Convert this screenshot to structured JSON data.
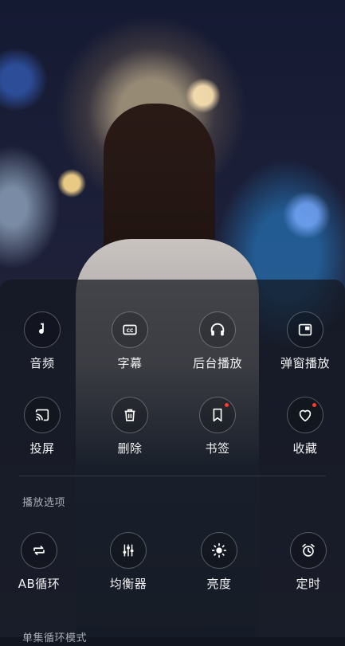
{
  "panel": {
    "row1": [
      {
        "label": "音频",
        "icon": "music-note-icon"
      },
      {
        "label": "字幕",
        "icon": "closed-caption-icon"
      },
      {
        "label": "后台播放",
        "icon": "headphones-icon"
      },
      {
        "label": "弹窗播放",
        "icon": "picture-in-picture-icon"
      }
    ],
    "row2": [
      {
        "label": "投屏",
        "icon": "cast-icon"
      },
      {
        "label": "删除",
        "icon": "trash-icon"
      },
      {
        "label": "书签",
        "icon": "bookmark-icon",
        "badge": true
      },
      {
        "label": "收藏",
        "icon": "heart-icon",
        "badge": true
      }
    ],
    "section_title": "播放选项",
    "row3": [
      {
        "label": "AB循环",
        "icon": "ab-loop-icon"
      },
      {
        "label": "均衡器",
        "icon": "equalizer-icon"
      },
      {
        "label": "亮度",
        "icon": "brightness-icon"
      },
      {
        "label": "定时",
        "icon": "alarm-clock-icon"
      }
    ],
    "section_title_2": "单集循环模式"
  },
  "colors": {
    "badge": "#ff3b30",
    "label": "#f2f2f2",
    "section_title": "#a9acb3"
  }
}
